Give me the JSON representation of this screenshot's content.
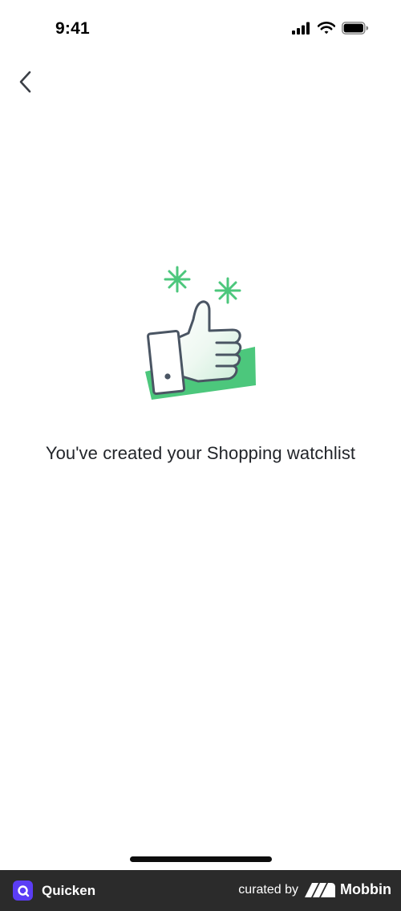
{
  "status_bar": {
    "time": "9:41",
    "icons": [
      "signal-icon",
      "wifi-icon",
      "battery-icon"
    ]
  },
  "nav": {
    "back_icon": "chevron-left-icon"
  },
  "illustration": {
    "icon": "thumbs-up-icon",
    "accent_color": "#4cc77c"
  },
  "main": {
    "message": "You've created your Shopping watchlist"
  },
  "footer": {
    "app_name": "Quicken",
    "curated_by": "curated by",
    "brand": "Mobbin"
  }
}
